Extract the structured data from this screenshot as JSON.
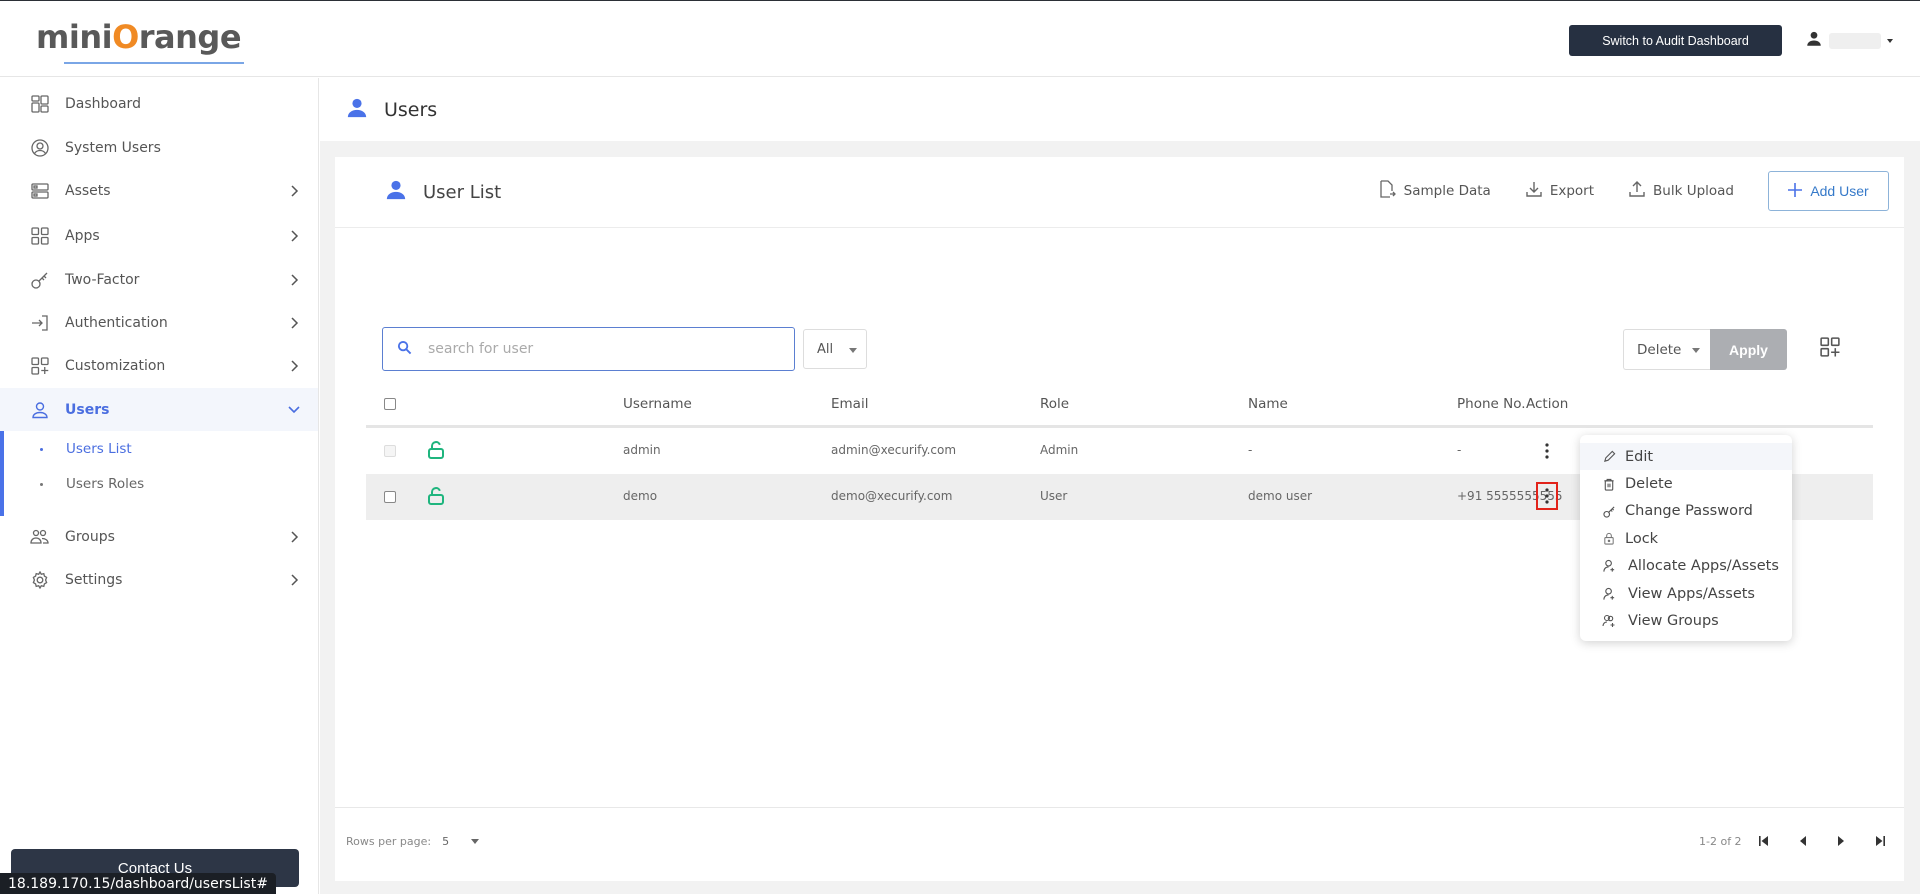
{
  "header": {
    "logo": {
      "part1": "mini",
      "part2": "O",
      "part3": "range"
    },
    "audit_button": "Switch to Audit Dashboard",
    "user_icon": "user-icon"
  },
  "sidebar": {
    "items": [
      {
        "label": "Dashboard",
        "icon": "dashboard-icon",
        "has_chevron": false
      },
      {
        "label": "System Users",
        "icon": "user-circle-icon",
        "has_chevron": false
      },
      {
        "label": "Assets",
        "icon": "assets-icon",
        "has_chevron": true
      },
      {
        "label": "Apps",
        "icon": "apps-grid-icon",
        "has_chevron": true
      },
      {
        "label": "Two-Factor",
        "icon": "key-icon",
        "has_chevron": true
      },
      {
        "label": "Authentication",
        "icon": "login-icon",
        "has_chevron": true
      },
      {
        "label": "Customization",
        "icon": "customize-grid-icon",
        "has_chevron": true
      },
      {
        "label": "Users",
        "icon": "user-icon",
        "has_chevron": true,
        "expanded": true,
        "active": true
      },
      {
        "label": "Groups",
        "icon": "groups-icon",
        "has_chevron": true
      },
      {
        "label": "Settings",
        "icon": "gear-icon",
        "has_chevron": true
      }
    ],
    "sub_items": [
      {
        "label": "Users List",
        "active": true
      },
      {
        "label": "Users Roles",
        "active": false
      }
    ],
    "contact_button": "Contact Us"
  },
  "status_bar": {
    "url": "18.189.170.15/dashboard/usersList#"
  },
  "page": {
    "title": "Users"
  },
  "card": {
    "title": "User List",
    "actions": {
      "sample_data": "Sample Data",
      "export": "Export",
      "bulk_upload": "Bulk Upload",
      "add_user": "Add User"
    },
    "search": {
      "placeholder": "search for user",
      "value": ""
    },
    "filter": {
      "selected": "All"
    },
    "bulk_action": {
      "selected": "Delete",
      "apply": "Apply"
    }
  },
  "table": {
    "columns": [
      "Username",
      "Email",
      "Role",
      "Name",
      "Phone No.",
      "Action"
    ],
    "rows": [
      {
        "username": "admin",
        "email": "admin@xecurify.com",
        "role": "Admin",
        "name": "-",
        "phone": "-",
        "locked": false,
        "checkbox_disabled": true
      },
      {
        "username": "demo",
        "email": "demo@xecurify.com",
        "role": "User",
        "name": "demo user",
        "phone": "+91 5555555555",
        "locked": false,
        "checkbox_disabled": false
      }
    ]
  },
  "action_menu": {
    "items": [
      {
        "label": "Edit",
        "icon": "pencil-icon"
      },
      {
        "label": "Delete",
        "icon": "trash-icon"
      },
      {
        "label": "Change Password",
        "icon": "key-icon"
      },
      {
        "label": "Lock",
        "icon": "lock-icon"
      },
      {
        "label": "Allocate Apps/Assets",
        "icon": "user-add-icon"
      },
      {
        "label": "View Apps/Assets",
        "icon": "user-add-icon"
      },
      {
        "label": "View Groups",
        "icon": "users-add-icon"
      }
    ]
  },
  "pagination": {
    "rows_per_page_label": "Rows per page:",
    "rows_per_page": "5",
    "range": "1-2 of 2"
  },
  "colors": {
    "accent": "#4a72e8",
    "dark_button": "#263041",
    "lock_green": "#1fb57e",
    "focus_red": "#e2231a",
    "logo_orange": "#f08a24"
  }
}
